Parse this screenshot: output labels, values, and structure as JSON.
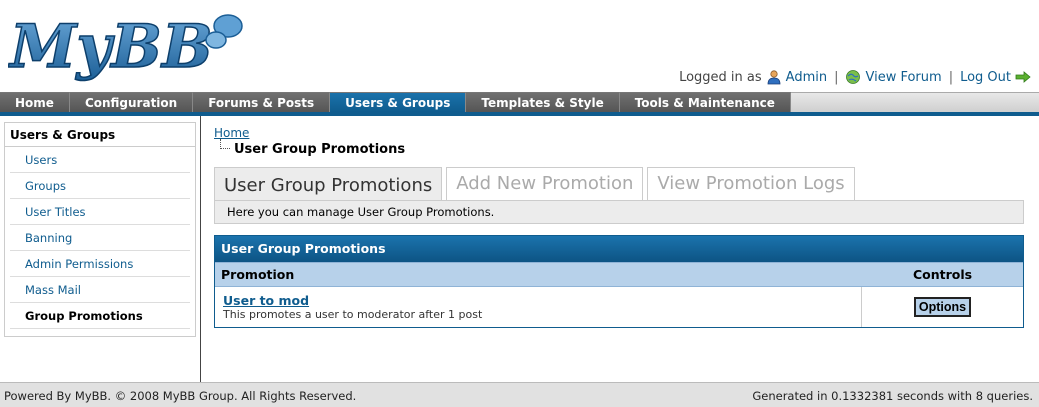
{
  "logo": {
    "text": "MyBB"
  },
  "welcome": {
    "logged_in_as": "Logged in as",
    "user": "Admin",
    "view_forum": "View Forum",
    "log_out": "Log Out",
    "separator": "|"
  },
  "menu": {
    "items": [
      {
        "label": "Home"
      },
      {
        "label": "Configuration"
      },
      {
        "label": "Forums & Posts"
      },
      {
        "label": "Users & Groups"
      },
      {
        "label": "Templates & Style"
      },
      {
        "label": "Tools & Maintenance"
      }
    ],
    "active_index": 3
  },
  "sidebar": {
    "title": "Users & Groups",
    "items": [
      {
        "label": "Users"
      },
      {
        "label": "Groups"
      },
      {
        "label": "User Titles"
      },
      {
        "label": "Banning"
      },
      {
        "label": "Admin Permissions"
      },
      {
        "label": "Mass Mail"
      },
      {
        "label": "Group Promotions"
      }
    ]
  },
  "breadcrumb": {
    "home": "Home",
    "current": "User Group Promotions"
  },
  "tabs": [
    {
      "label": "User Group Promotions"
    },
    {
      "label": "Add New Promotion"
    },
    {
      "label": "View Promotion Logs"
    }
  ],
  "tab_description": "Here you can manage User Group Promotions.",
  "table": {
    "title": "User Group Promotions",
    "columns": {
      "promotion": "Promotion",
      "controls": "Controls"
    },
    "rows": [
      {
        "title": "User to mod",
        "description": "This promotes a user to moderator after 1 post",
        "button": "Options"
      }
    ]
  },
  "footer": {
    "left": "Powered By MyBB. © 2008 MyBB Group. All Rights Reserved.",
    "right": "Generated in 0.1332381 seconds with 8 queries."
  },
  "colors": {
    "accent": "#0f5c8e",
    "menu_bg": "#666666",
    "table_header": "#0f5c8e",
    "column_header": "#b7d1ea"
  }
}
